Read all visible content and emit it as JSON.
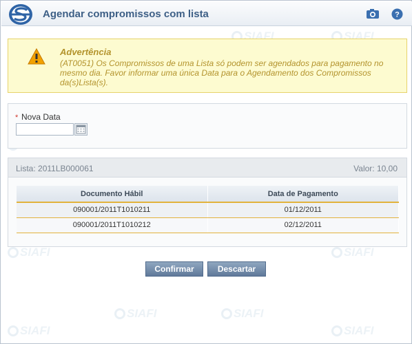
{
  "header": {
    "title": "Agendar compromissos com lista",
    "camera_icon": "camera-icon",
    "help_icon": "help-icon",
    "help_glyph": "?"
  },
  "watermark": {
    "text": "SIAFI"
  },
  "warning": {
    "icon": "warning-icon",
    "title": "Advertência",
    "message": "(AT0051) Os Compromissos de uma Lista só podem ser agendados para pagamento no mesmo dia. Favor informar uma única Data para o Agendamento dos Compromissos da(s)Lista(s)."
  },
  "form": {
    "required_mark": "*",
    "date_label": "Nova Data",
    "date_value": "",
    "calendar_icon": "calendar-icon"
  },
  "list": {
    "label": "Lista: 2011LB000061",
    "value": "Valor: 10,00",
    "columns": [
      "Documento Hábil",
      "Data de Pagamento"
    ],
    "rows": [
      {
        "document": "090001/2011T1010211",
        "date": "01/12/2011"
      },
      {
        "document": "090001/2011T1010212",
        "date": "02/12/2011"
      }
    ]
  },
  "actions": {
    "confirm_label": "Confirmar",
    "discard_label": "Descartar"
  },
  "colors": {
    "title": "#3d5f86",
    "warning_text": "#b3932c",
    "warning_bg": "#fdfbd0",
    "button": "#60799a",
    "row_rule": "#e2b23b"
  }
}
